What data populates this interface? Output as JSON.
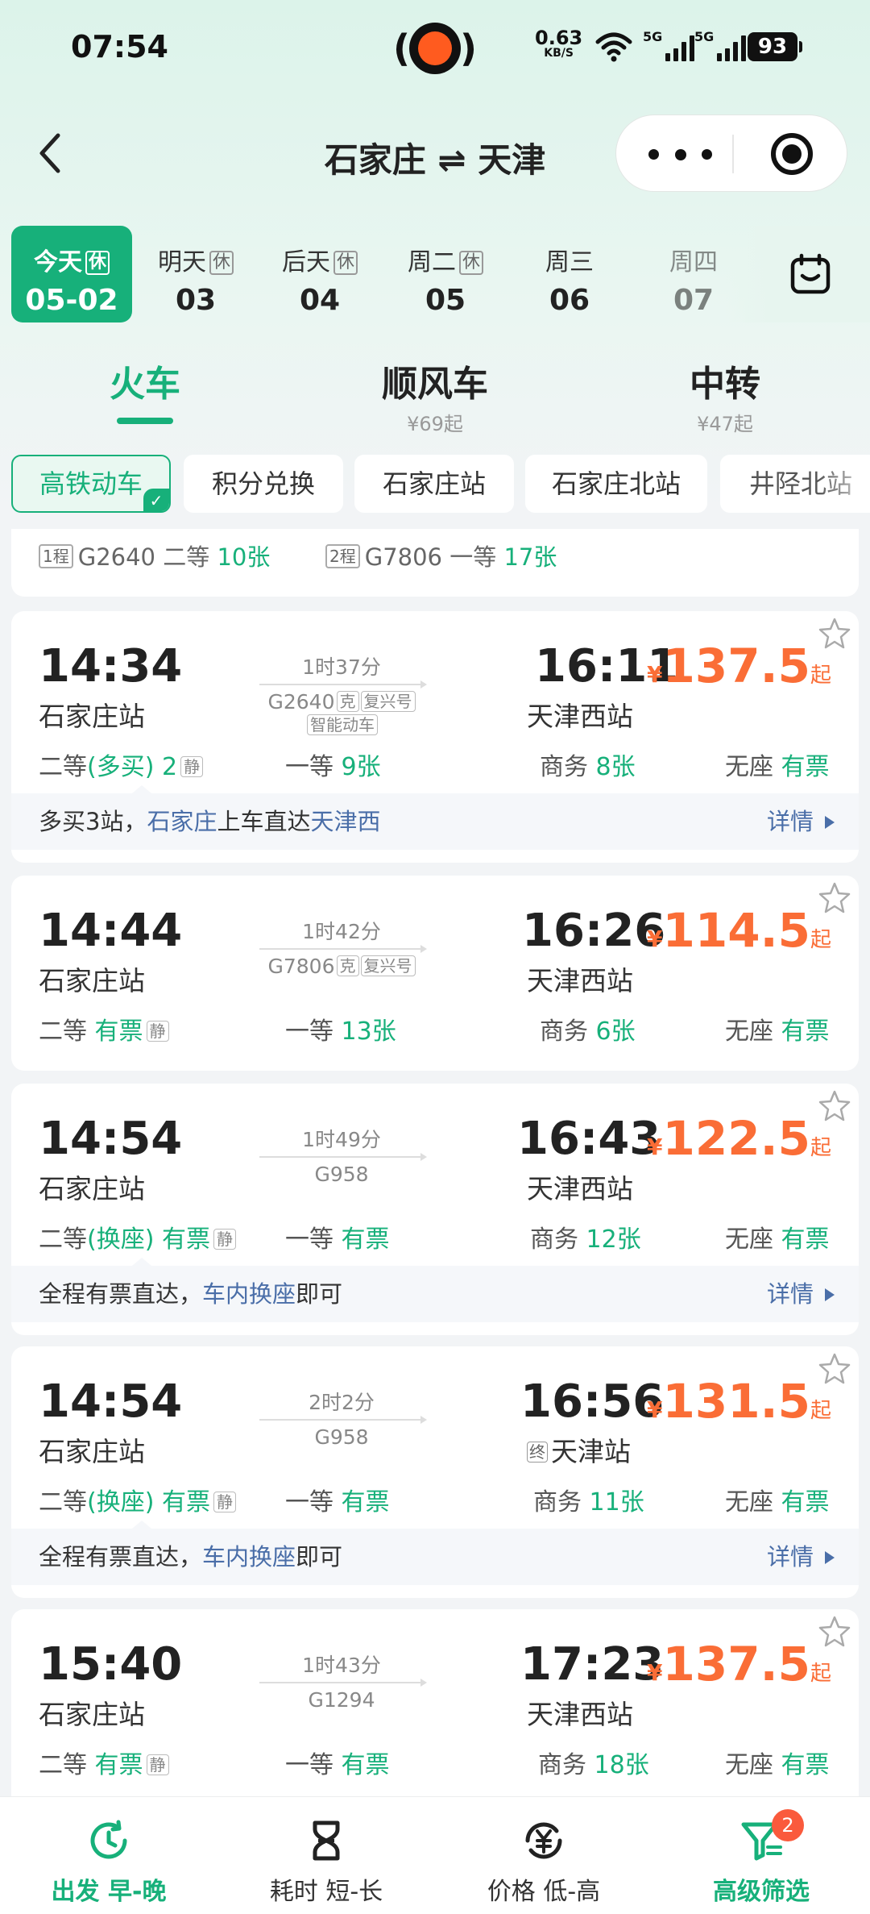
{
  "status": {
    "time": "07:54",
    "net_speed": "0.63",
    "net_unit": "KB/S",
    "sig1": "5G",
    "sig2": "5G",
    "battery": "93"
  },
  "header": {
    "from": "石家庄",
    "arrow": "⇌",
    "to": "天津",
    "back_icon": "chevron-left-icon",
    "more_icon": "more-dots-icon",
    "close_icon": "target-icon"
  },
  "dates": [
    {
      "label": "今天",
      "day": "05-02",
      "holiday": "休",
      "active": true
    },
    {
      "label": "明天",
      "day": "03",
      "holiday": "休"
    },
    {
      "label": "后天",
      "day": "04",
      "holiday": "休"
    },
    {
      "label": "周二",
      "day": "05",
      "holiday": "休"
    },
    {
      "label": "周三",
      "day": "06",
      "holiday": ""
    },
    {
      "label": "周四",
      "day": "07",
      "holiday": ""
    }
  ],
  "modes": [
    {
      "label": "火车",
      "sub": ""
    },
    {
      "label": "顺风车",
      "sub": "¥69起"
    },
    {
      "label": "中转",
      "sub": "¥47起"
    }
  ],
  "chips": [
    "高铁动车",
    "积分兑换",
    "石家庄站",
    "石家庄北站",
    "井陉北站"
  ],
  "strip": {
    "tag1": "1程",
    "train1": "G2640",
    "cls1": "二等",
    "cnt1": "10张",
    "tag2": "2程",
    "train2": "G7806",
    "cls2": "一等",
    "cnt2": "17张"
  },
  "trains": [
    {
      "dep": "14:34",
      "arr": "16:11",
      "from": "石家庄站",
      "to": "天津西站",
      "dur": "1时37分",
      "no": "G2640",
      "tags": [
        "克",
        "复兴号"
      ],
      "extra": "智能动车",
      "price": "137.5",
      "s1l": "二等",
      "s1m": "(多买)",
      "s1v": "2",
      "s2l": "一等",
      "s2v": "9张",
      "s3l": "商务",
      "s3v": "8张",
      "s4l": "无座",
      "s4v": "有票",
      "note": {
        "a": "多买3站，",
        "b": "石家庄",
        "c": "上车直达",
        "d": "天津西",
        "e": ""
      },
      "detail": "详情"
    },
    {
      "dep": "14:44",
      "arr": "16:26",
      "from": "石家庄站",
      "to": "天津西站",
      "dur": "1时42分",
      "no": "G7806",
      "tags": [
        "克",
        "复兴号"
      ],
      "price": "114.5",
      "s1l": "二等",
      "s1v": "有票",
      "s2l": "一等",
      "s2v": "13张",
      "s3l": "商务",
      "s3v": "6张",
      "s4l": "无座",
      "s4v": "有票"
    },
    {
      "dep": "14:54",
      "arr": "16:43",
      "from": "石家庄站",
      "to": "天津西站",
      "dur": "1时49分",
      "no": "G958",
      "price": "122.5",
      "s1l": "二等",
      "s1m": "(换座)",
      "s1v": "有票",
      "s2l": "一等",
      "s2v": "有票",
      "s3l": "商务",
      "s3v": "12张",
      "s4l": "无座",
      "s4v": "有票",
      "note": {
        "a": "全程有票直达，",
        "b": "车内换座",
        "c": "即可"
      },
      "detail": "详情"
    },
    {
      "dep": "14:54",
      "arr": "16:56",
      "from": "石家庄站",
      "to": "天津站",
      "to_tag": "终",
      "dur": "2时2分",
      "no": "G958",
      "price": "131.5",
      "s1l": "二等",
      "s1m": "(换座)",
      "s1v": "有票",
      "s2l": "一等",
      "s2v": "有票",
      "s3l": "商务",
      "s3v": "11张",
      "s4l": "无座",
      "s4v": "有票",
      "note": {
        "a": "全程有票直达，",
        "b": "车内换座",
        "c": "即可"
      },
      "detail": "详情"
    },
    {
      "dep": "15:40",
      "arr": "17:23",
      "from": "石家庄站",
      "to": "天津西站",
      "dur": "1时43分",
      "no": "G1294",
      "price": "137.5",
      "s1l": "二等",
      "s1v": "有票",
      "s2l": "一等",
      "s2v": "有票",
      "s3l": "商务",
      "s3v": "18张",
      "s4l": "无座",
      "s4v": "有票"
    }
  ],
  "price_prefix": "¥",
  "price_suffix": "起",
  "quiet_tag": "静",
  "bottom": [
    {
      "label": "出发 早-晚",
      "icon": "clock-icon"
    },
    {
      "label": "耗时 短-长",
      "icon": "hourglass-icon"
    },
    {
      "label": "价格 低-高",
      "icon": "yuan-refresh-icon"
    },
    {
      "label": "高级筛选",
      "icon": "filter-icon"
    }
  ],
  "filter_badge": "2",
  "colors": {
    "brand": "#17b07a",
    "price": "#fa6d36",
    "link": "#4a6ea8"
  }
}
